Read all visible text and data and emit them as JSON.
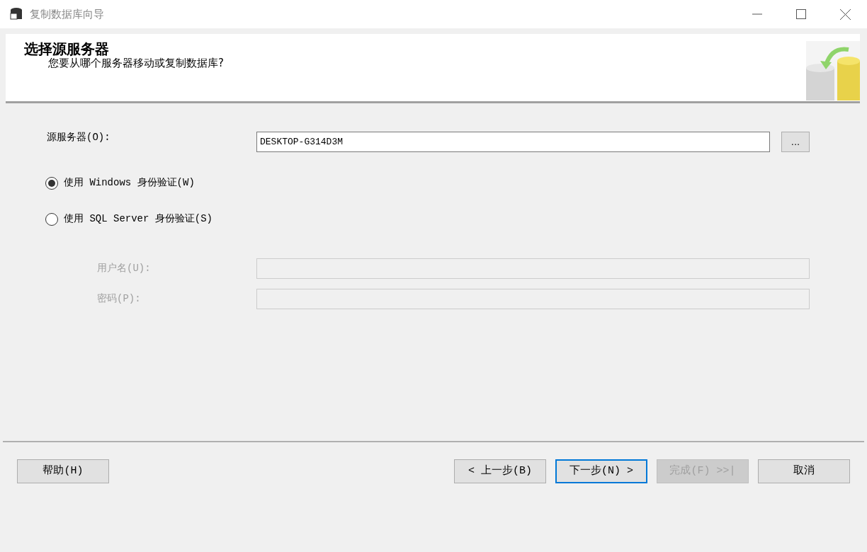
{
  "window": {
    "title": "复制数据库向导"
  },
  "header": {
    "title": "选择源服务器",
    "subtitle": "您要从哪个服务器移动或复制数据库?"
  },
  "source_server": {
    "label": "源服务器(O):",
    "value": "DESKTOP-G314D3M",
    "browse_button": "..."
  },
  "auth_options": [
    {
      "label": "使用 Windows 身份验证(W)",
      "selected": true
    },
    {
      "label": "使用 SQL Server 身份验证(S)",
      "selected": false
    }
  ],
  "credentials": [
    {
      "label": "用户名(U):",
      "disabled": true
    },
    {
      "label": "密码(P):",
      "disabled": true
    }
  ],
  "buttons": [
    {
      "label": "帮助(H)",
      "kind": "help",
      "disabled": false,
      "focused": false
    },
    {
      "label": "< 上一步(B)",
      "kind": "nav",
      "disabled": false,
      "focused": false
    },
    {
      "label": "下一步(N) >",
      "kind": "nav",
      "disabled": false,
      "focused": true
    },
    {
      "label": "完成(F) >>|",
      "kind": "nav",
      "disabled": true,
      "focused": false
    },
    {
      "label": "取消",
      "kind": "nav",
      "disabled": false,
      "focused": false
    }
  ]
}
